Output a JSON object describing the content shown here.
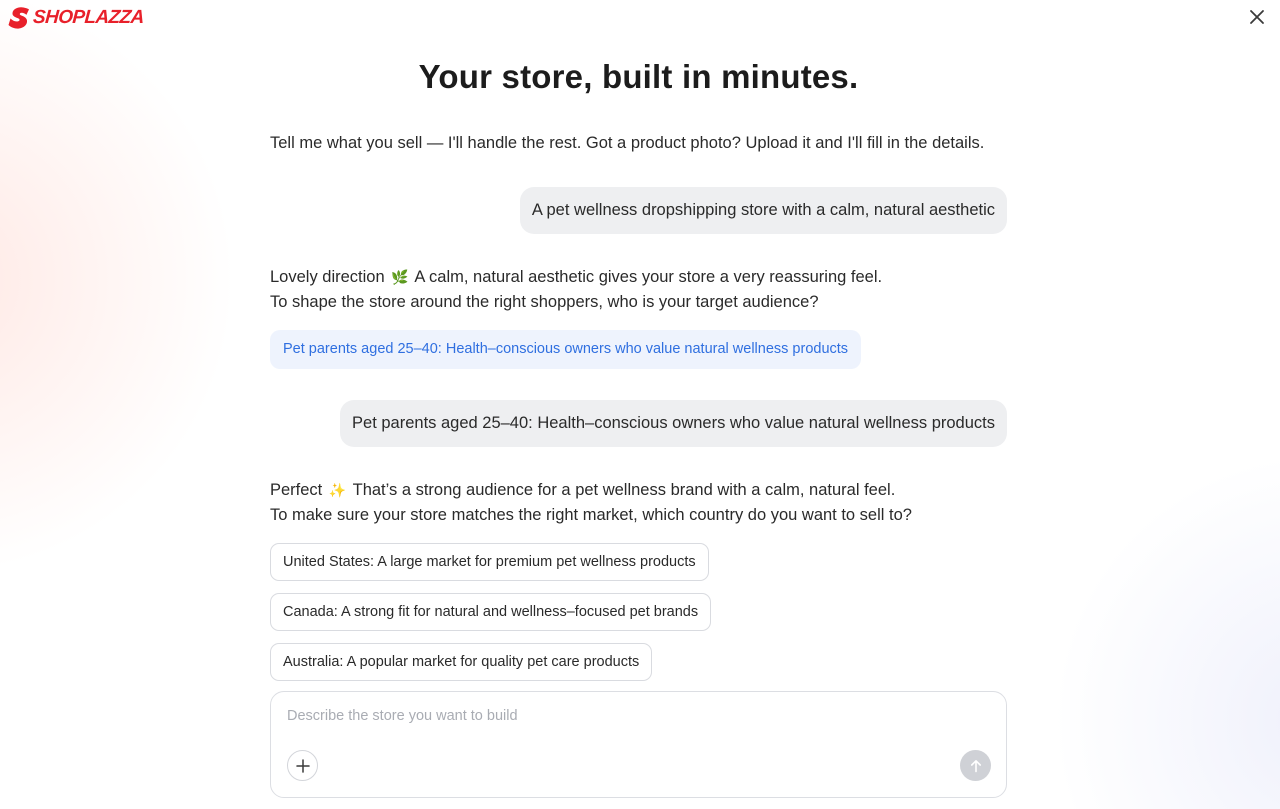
{
  "brand": {
    "name": "SHOPLAZZA",
    "logo_icon": "shoplazza-logo-icon",
    "color": "#e8202a"
  },
  "header": {
    "close_icon": "close-icon"
  },
  "page": {
    "title": "Your store, built in minutes.",
    "intro": "Tell me what you sell — I'll handle the rest. Got a product photo? Upload it and I'll fill in the details."
  },
  "conversation": {
    "user_message_1": "A pet wellness dropshipping store with a calm, natural aesthetic",
    "assistant_message_1": {
      "line1_prefix": "Lovely direction",
      "line1_emoji": "🌿",
      "line1_suffix": "A calm, natural aesthetic gives your store a very reassuring feel.",
      "line2": "To shape the store around the right shoppers, who is your target audience?"
    },
    "selected_suggestion": "Pet parents aged 25–40: Health–conscious owners who value natural wellness products",
    "user_message_2": "Pet parents aged 25–40: Health–conscious owners who value natural wellness products",
    "assistant_message_2": {
      "line1_prefix": "Perfect",
      "line1_emoji": "✨",
      "line1_suffix": "That’s a strong audience for a pet wellness brand with a calm, natural feel.",
      "line2": "To make sure your store matches the right market, which country do you want to sell to?"
    },
    "options": [
      "United States: A large market for premium pet wellness products",
      "Canada: A strong fit for natural and wellness–focused pet brands",
      "Australia: A popular market for quality pet care products"
    ]
  },
  "composer": {
    "placeholder": "Describe the store you want to build",
    "value": "",
    "attach_icon": "plus-icon",
    "send_icon": "arrow-up-icon"
  },
  "colors": {
    "accent_blue": "#2f6fe0",
    "suggestion_bg": "#eef3fd",
    "bubble_bg": "#eeeff1",
    "send_disabled": "#cfd1d6"
  }
}
